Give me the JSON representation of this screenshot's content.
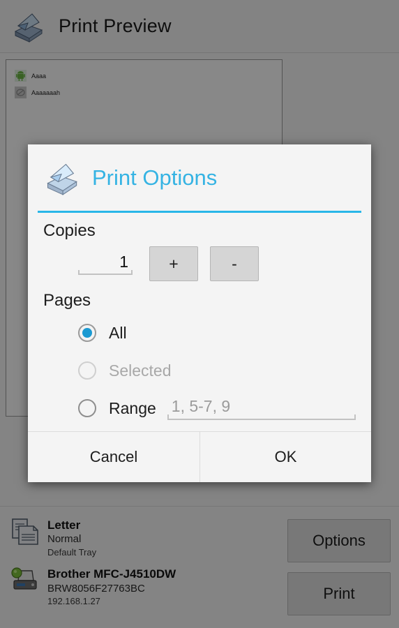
{
  "app": {
    "header": {
      "icon": "printer-scanner-icon",
      "title": "Print Preview"
    },
    "preview": {
      "rows": [
        {
          "icon": "android-robot-icon",
          "label": "Aaaa"
        },
        {
          "icon": "no-image-icon",
          "label": "Aaaaaaah"
        }
      ]
    },
    "footer": {
      "paper": {
        "icon": "documents-icon",
        "title": "Letter",
        "quality": "Normal",
        "tray": "Default Tray"
      },
      "printer": {
        "icon": "printer-status-icon",
        "name": "Brother MFC-J4510DW",
        "node": "BRW8056F27763BC",
        "ip": "192.168.1.27"
      },
      "buttons": {
        "options": "Options",
        "print": "Print"
      }
    }
  },
  "dialog": {
    "icon": "printer-scanner-icon",
    "title": "Print Options",
    "accent_color": "#29b6e8",
    "copies": {
      "label": "Copies",
      "value": "1",
      "increment_label": "+",
      "decrement_label": "-"
    },
    "pages": {
      "label": "Pages",
      "options": [
        {
          "label": "All",
          "checked": true,
          "disabled": false
        },
        {
          "label": "Selected",
          "checked": false,
          "disabled": true
        },
        {
          "label": "Range",
          "checked": false,
          "disabled": false
        }
      ],
      "range_placeholder": "1, 5-7, 9",
      "range_value": ""
    },
    "buttons": {
      "cancel": "Cancel",
      "ok": "OK"
    }
  }
}
